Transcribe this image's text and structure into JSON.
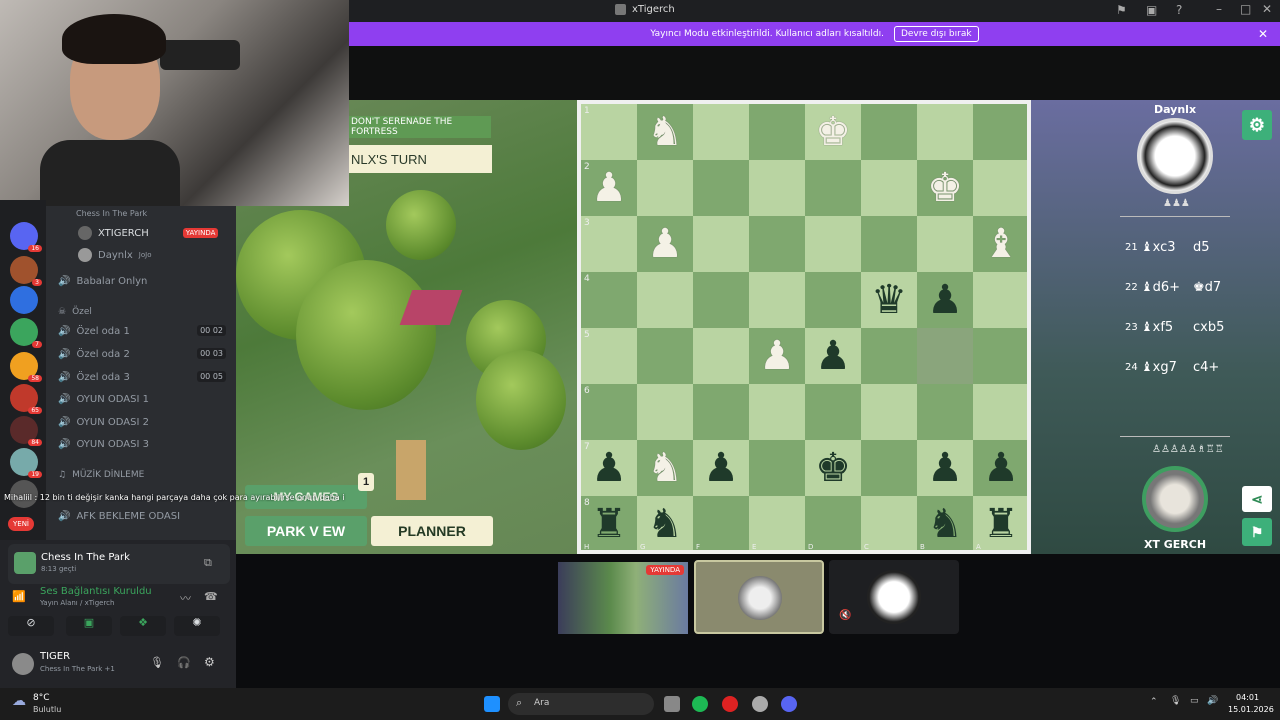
{
  "window": {
    "title": "xTigerch"
  },
  "banner": {
    "message": "Yayıncı Modu etkinleştirildi. Kullanıcı adları kısaltıldı.",
    "button": "Devre dışı bırak"
  },
  "sidebar": {
    "badges": [
      "16",
      "3",
      "7",
      "58",
      "65",
      "84",
      "19"
    ],
    "new_label": "YENİ",
    "stream_title": "Chess In The Park",
    "voice_users": [
      {
        "name": "XTIGERCH",
        "tag": "YAYINDA"
      },
      {
        "name": "Daynlx",
        "tag": "JoJo"
      }
    ],
    "channels": [
      {
        "name": "Babalar Onlyn"
      },
      {
        "category": "Özel"
      },
      {
        "name": "Özel oda 1",
        "count": "00",
        "max": "02"
      },
      {
        "name": "Özel oda 2",
        "count": "00",
        "max": "03"
      },
      {
        "name": "Özel oda 3",
        "count": "00",
        "max": "05"
      },
      {
        "name": "OYUN ODASI 1"
      },
      {
        "name": "OYUN ODASI 2"
      },
      {
        "name": "OYUN ODASI 3"
      },
      {
        "category": "MÜZİK DİNLEME"
      },
      {
        "name": "AFK BEKLEME ODASI"
      }
    ],
    "chat_overlay": "Mihaliil : 12 bin ti değişir kanka hangi parçaya daha çok para ayırabilirse onun daha i"
  },
  "panel": {
    "activity_title": "Chess In The Park",
    "activity_time": "8:13 geçti",
    "voice_status": "Ses Bağlantısı Kuruldu",
    "voice_sub": "Yayın Alanı / xTigerch",
    "user_name": "TIGER",
    "user_status": "Chess In The Park +1"
  },
  "game": {
    "objective": "DON'T SERENADE THE FORTRESS",
    "turn": "NLX'S TURN",
    "my_games": "MY GAMES",
    "my_games_count": "1",
    "park_view": "PARK V EW",
    "planner": "PLANNER",
    "opponent": "Daynlx",
    "player": "XT GERCH",
    "ranks": [
      "1",
      "2",
      "3",
      "4",
      "5",
      "6",
      "7",
      "8"
    ],
    "files": [
      "H",
      "G",
      "F",
      "E",
      "D",
      "C",
      "B",
      "A"
    ],
    "moves": [
      {
        "n": "21",
        "w": "♝xc3",
        "b": "d5"
      },
      {
        "n": "22",
        "w": "♝d6+",
        "b": "♚d7"
      },
      {
        "n": "23",
        "w": "♝xf5",
        "b": "cxb5"
      },
      {
        "n": "24",
        "w": "♝xg7",
        "b": "c4+"
      }
    ]
  },
  "thumbs": {
    "live": "YAYINDA"
  },
  "taskbar": {
    "weather_temp": "8°C",
    "weather_desc": "Bulutlu",
    "search": "Ara",
    "time": "04:01",
    "date": "15.01.2026"
  }
}
